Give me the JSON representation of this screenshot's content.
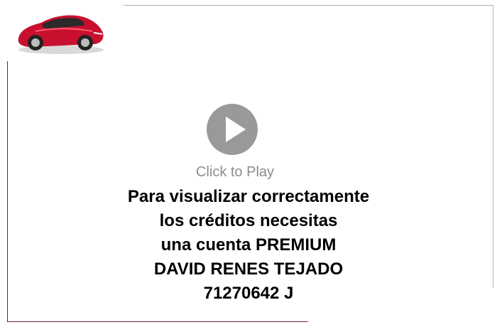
{
  "player": {
    "play_label": "Click to Play"
  },
  "message": {
    "lines": [
      "Para visualizar correctamente",
      "los créditos necesitas",
      "una cuenta PREMIUM",
      "DAVID RENES TEJADO",
      "71270642 J"
    ]
  },
  "logo": {
    "icon": "red-sports-car-icon"
  },
  "colors": {
    "frame_accent": "#7a1f33",
    "frame_gray": "#b0b0b0",
    "play_button": "#999999",
    "play_label": "#8c8c8c",
    "car_body": "#c8102e"
  }
}
